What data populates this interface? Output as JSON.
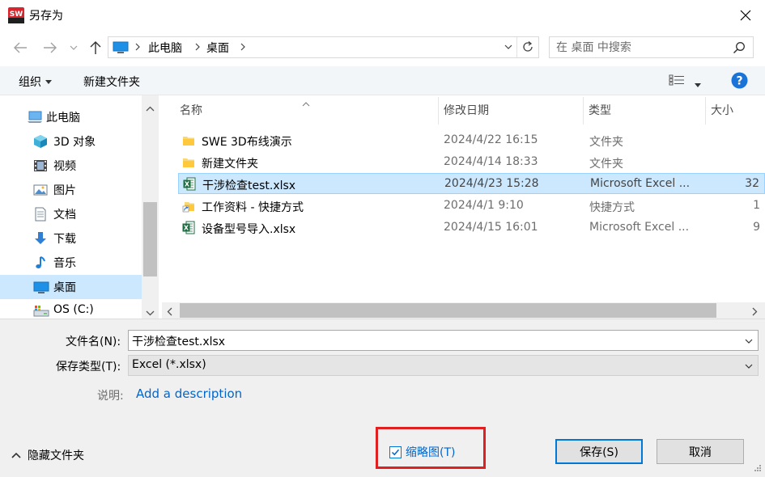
{
  "window": {
    "title": "另存为",
    "app_icon_text": "SW"
  },
  "address": {
    "path": [
      "此电脑",
      "桌面"
    ]
  },
  "search": {
    "placeholder": "在 桌面 中搜索"
  },
  "toolbar": {
    "organize_label": "组织",
    "new_folder_label": "新建文件夹"
  },
  "nav_pane": {
    "items": [
      {
        "label": "此电脑",
        "icon": "computer-icon"
      },
      {
        "label": "3D 对象",
        "icon": "cube-icon"
      },
      {
        "label": "视频",
        "icon": "video-icon"
      },
      {
        "label": "图片",
        "icon": "picture-icon"
      },
      {
        "label": "文档",
        "icon": "document-icon"
      },
      {
        "label": "下载",
        "icon": "download-icon"
      },
      {
        "label": "音乐",
        "icon": "music-icon"
      },
      {
        "label": "桌面",
        "icon": "desktop-icon",
        "selected": true
      },
      {
        "label": "OS (C:)",
        "icon": "drive-icon"
      }
    ]
  },
  "file_list": {
    "columns": {
      "name": "名称",
      "date": "修改日期",
      "type": "类型",
      "size": "大小"
    },
    "rows": [
      {
        "name": "SWE 3D布线演示",
        "date": "2024/4/22 16:15",
        "type": "文件夹",
        "size": "",
        "icon": "folder-icon"
      },
      {
        "name": "新建文件夹",
        "date": "2024/4/14 18:33",
        "type": "文件夹",
        "size": "",
        "icon": "folder-icon"
      },
      {
        "name": "干涉检查test.xlsx",
        "date": "2024/4/23 15:28",
        "type": "Microsoft Excel ...",
        "size": "32",
        "icon": "excel-icon",
        "selected": true
      },
      {
        "name": "工作资料 - 快捷方式",
        "date": "2024/4/1 9:10",
        "type": "快捷方式",
        "size": "1",
        "icon": "shortcut-folder-icon"
      },
      {
        "name": "设备型号导入.xlsx",
        "date": "2024/4/15 16:01",
        "type": "Microsoft Excel ...",
        "size": "9",
        "icon": "excel-icon"
      }
    ]
  },
  "form": {
    "filename_label": "文件名(N):",
    "filename_value": "干涉检查test.xlsx",
    "filetype_label": "保存类型(T):",
    "filetype_value": "Excel (*.xlsx)",
    "description_label": "说明:",
    "description_link": "Add a description",
    "thumbnail_label": "缩略图(T)",
    "thumbnail_checked": true
  },
  "footer": {
    "hide_folders_label": "隐藏文件夹",
    "save_label": "保存(S)",
    "cancel_label": "取消"
  },
  "colors": {
    "selection": "#cce8ff",
    "accent": "#0078d7",
    "link": "#0066cc",
    "highlight_box": "#e02020"
  }
}
